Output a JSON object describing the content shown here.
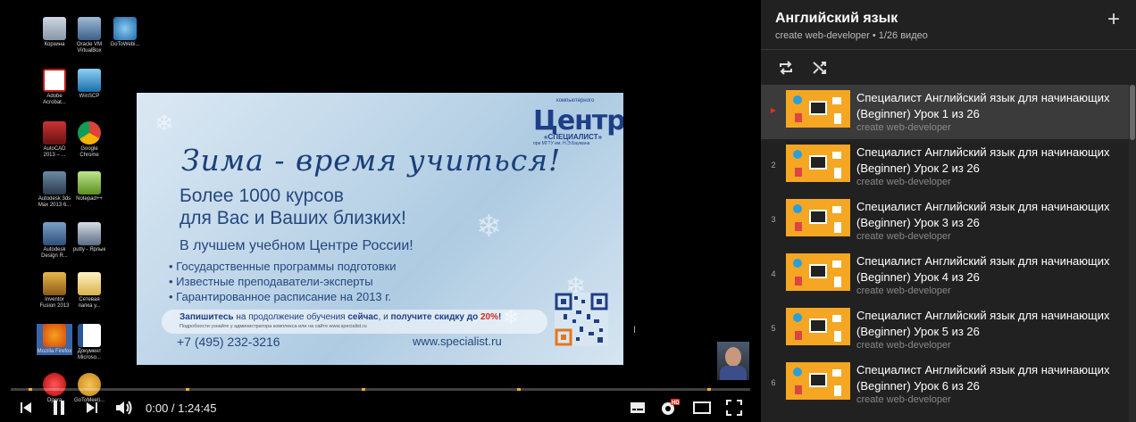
{
  "desktop": {
    "icons": [
      {
        "label": "Корзина"
      },
      {
        "label": "Oracle VM VirtualBox"
      },
      {
        "label": "GoToWebi..."
      },
      {
        "label": "Adobe Acrobat..."
      },
      {
        "label": "WinSCP"
      },
      {
        "label": "AutoCAD 2013 – ..."
      },
      {
        "label": "Google Chrome"
      },
      {
        "label": "Autodesk 3ds Max 2013 6..."
      },
      {
        "label": "Notepad++"
      },
      {
        "label": "Autodesk Design R..."
      },
      {
        "label": "putty - Ярлык"
      },
      {
        "label": "Inventor Fusion 2013"
      },
      {
        "label": "Сетевая папка у..."
      },
      {
        "label": "Mozilla Firefox"
      },
      {
        "label": "Документ Microso..."
      },
      {
        "label": "Opera"
      },
      {
        "label": "GoToMeeti..."
      }
    ]
  },
  "banner": {
    "logo_top": "компьютерного",
    "logo_word": "Центр",
    "logo_sub": "«СПЕЦИАЛИСТ»",
    "logo_sub2": "при МГТУ им. Н.Э.Баумана",
    "title": "Зима - время учиться!",
    "line1": "Более 1000 курсов",
    "line2": "для Вас и Ваших близких!",
    "line3": "В лучшем учебном Центре России!",
    "bullets": [
      "• Государственные программы подготовки",
      "• Известные преподаватели-эксперты",
      "• Гарантированное расписание на 2013 г."
    ],
    "promo_a": "Запишитесь",
    "promo_b": " на продолжение обучения ",
    "promo_c": "сейчас",
    "promo_d": ", и ",
    "promo_e": "получите скидку до ",
    "promo_f": "20%",
    "promo_g": "!",
    "promo_small": "Подробности узнайте у администратора комплекса или на сайте www.specialist.ru",
    "phone": "+7 (495) 232-3216",
    "site": "www.specialist.ru"
  },
  "player": {
    "time": "0:00 / 1:24:45",
    "progress_fraction": 0
  },
  "playlist": {
    "title": "Английский язык",
    "subtitle": "create web-developer • 1/26 видео",
    "add_icon": "+",
    "items": [
      {
        "index": "▶",
        "title": "Специалист Английский язык для начинающих (Beginner) Урок 1 из 26",
        "channel": "create web-developer",
        "active": true
      },
      {
        "index": "2",
        "title": "Специалист Английский язык для начинающих (Beginner) Урок 2 из 26",
        "channel": "create web-developer"
      },
      {
        "index": "3",
        "title": "Специалист Английский язык для начинающих (Beginner) Урок 3 из 26",
        "channel": "create web-developer"
      },
      {
        "index": "4",
        "title": "Специалист Английский язык для начинающих (Beginner) Урок 4 из 26",
        "channel": "create web-developer"
      },
      {
        "index": "5",
        "title": "Специалист Английский язык для начинающих (Beginner) Урок 5 из 26",
        "channel": "create web-developer"
      },
      {
        "index": "6",
        "title": "Специалист Английский язык для начинающих (Beginner) Урок 6 из 26",
        "channel": "create web-developer"
      }
    ]
  },
  "colors": {
    "accent": "#f2b21b",
    "play_indicator": "#e0301e",
    "thumbnail": "#f5a623",
    "hd_badge": "#e0301e"
  }
}
